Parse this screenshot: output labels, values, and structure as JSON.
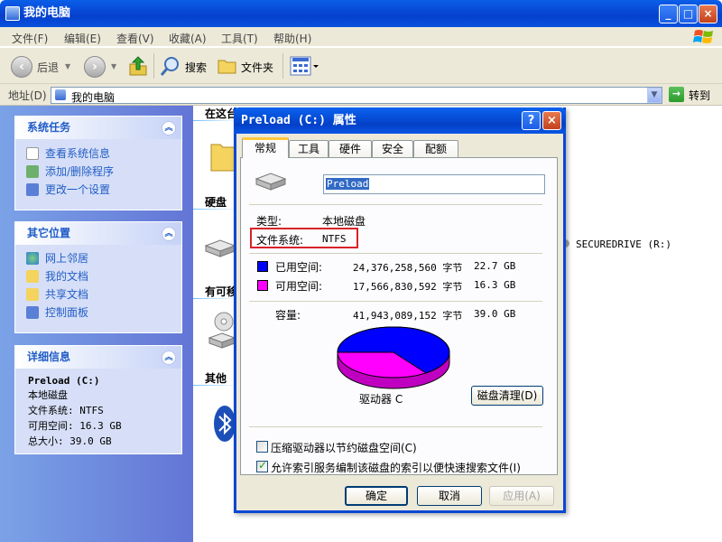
{
  "window": {
    "title": "我的电脑"
  },
  "menu": [
    "文件(F)",
    "编辑(E)",
    "查看(V)",
    "收藏(A)",
    "工具(T)",
    "帮助(H)"
  ],
  "toolbar": {
    "back": "后退",
    "search": "搜索",
    "folders": "文件夹"
  },
  "address": {
    "label": "地址(D)",
    "value": "我的电脑",
    "go": "转到"
  },
  "left": {
    "system_tasks": {
      "title": "系统任务",
      "items": [
        "查看系统信息",
        "添加/删除程序",
        "更改一个设置"
      ]
    },
    "other_places": {
      "title": "其它位置",
      "items": [
        "网上邻居",
        "我的文档",
        "共享文档",
        "控制面板"
      ]
    },
    "details": {
      "title": "详细信息",
      "name": "Preload (C:)",
      "type": "本地磁盘",
      "fs": "文件系统: NTFS",
      "free": "可用空间: 16.3 GB",
      "total": "总大小: 39.0 GB"
    }
  },
  "content": {
    "groups": [
      "在这台",
      "硬盘",
      "有可移",
      "其他"
    ],
    "securedrive": "SECUREDRIVE (R:)"
  },
  "dialog": {
    "title": "Preload (C:) 属性",
    "help": "?",
    "close": "×",
    "tabs": [
      "常规",
      "工具",
      "硬件",
      "安全",
      "配额"
    ],
    "volume_label": "Preload",
    "type_label": "类型:",
    "type_value": "本地磁盘",
    "fs_label": "文件系统:",
    "fs_value": "NTFS",
    "used_label": "已用空间:",
    "used_bytes": "24,376,258,560 字节",
    "used_gb": "22.7 GB",
    "free_label": "可用空间:",
    "free_bytes": "17,566,830,592 字节",
    "free_gb": "16.3 GB",
    "cap_label": "容量:",
    "cap_bytes": "41,943,089,152 字节",
    "cap_gb": "39.0 GB",
    "drive_label": "驱动器 C",
    "cleanup": "磁盘清理(D)",
    "compress": "压缩驱动器以节约磁盘空间(C)",
    "index": "允许索引服务编制该磁盘的索引以便快速搜索文件(I)",
    "ok": "确定",
    "cancel": "取消",
    "apply": "应用(A)"
  },
  "colors": {
    "used": "#0000ff",
    "free": "#ff00ff"
  }
}
